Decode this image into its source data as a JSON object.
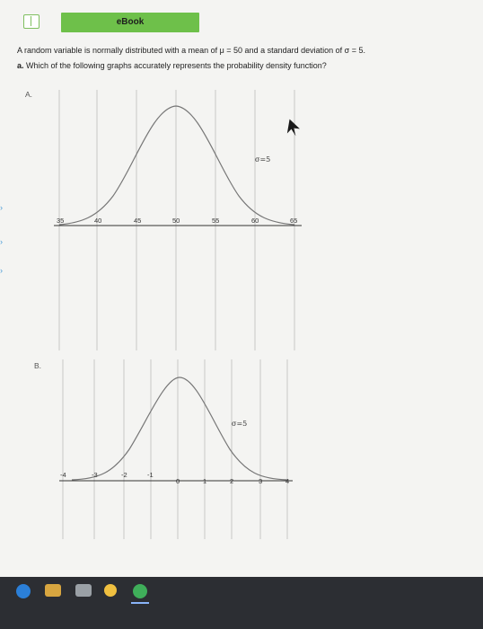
{
  "ebook": {
    "label": "eBook"
  },
  "question": {
    "intro_text": "A random variable is normally distributed with a mean of μ = 50 and a standard deviation of σ = 5.",
    "part_a_prefix": "a.",
    "part_a_text": "Which of the following graphs accurately represents the probability density function?"
  },
  "options": [
    {
      "label": "A.",
      "sigma_label": "σ=5",
      "ticks": [
        "35",
        "40",
        "45",
        "50",
        "55",
        "60",
        "65"
      ]
    },
    {
      "label": "B.",
      "sigma_label": "σ=5",
      "ticks": [
        "-4",
        "-3",
        "-2",
        "-1",
        "0",
        "1",
        "2",
        "3",
        "4"
      ]
    }
  ],
  "taskbar": {
    "icons": [
      "edge-icon",
      "file-explorer-icon",
      "store-icon",
      "app-icon",
      "chrome-icon"
    ]
  }
}
